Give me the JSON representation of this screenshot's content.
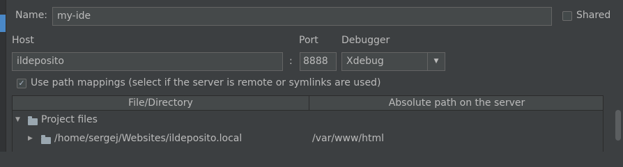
{
  "form": {
    "name_label": "Name:",
    "name_value": "my-ide",
    "shared_label": "Shared",
    "shared_checked": false,
    "host_label": "Host",
    "host_value": "ildeposito",
    "colon": ":",
    "port_label": "Port",
    "port_value": "8888",
    "debugger_label": "Debugger",
    "debugger_value": "Xdebug",
    "path_mappings_label": "Use path mappings (select if the server is remote or symlinks are used)",
    "path_mappings_checked": true
  },
  "mappings_table": {
    "columns": [
      "File/Directory",
      "Absolute path on the server"
    ],
    "rows": [
      {
        "expander": "expanded",
        "file": "Project files",
        "server_path": ""
      },
      {
        "expander": "collapsed",
        "file": "/home/sergej/Websites/ildeposito.local",
        "server_path": "/var/www/html"
      }
    ]
  },
  "icons": {
    "checkbox_checked": "✓",
    "expanded_triangle": "▼",
    "collapsed_triangle": "▶",
    "dropdown_arrow": "▼"
  },
  "colors": {
    "background": "#3c3f41",
    "input_background": "#45494a",
    "text": "#bbbbbb",
    "accent": "#4a88c7"
  }
}
